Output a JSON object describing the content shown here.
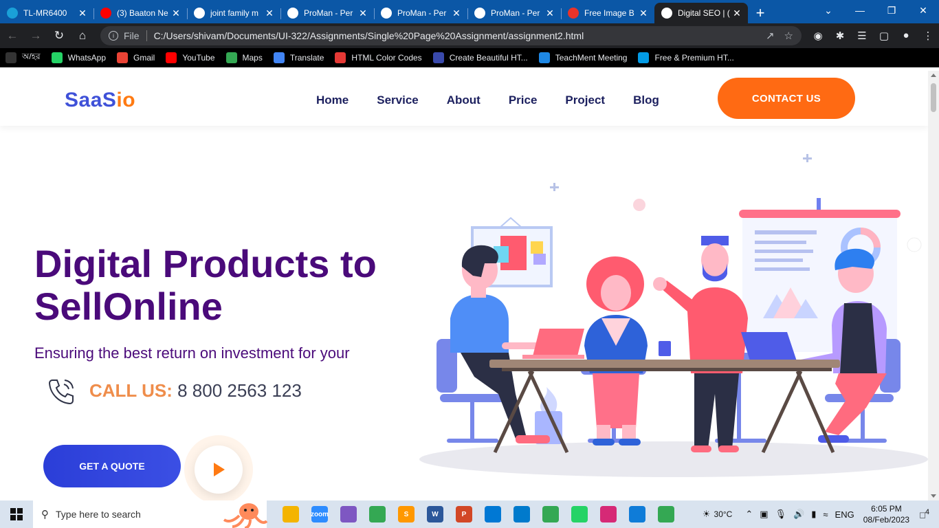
{
  "browser": {
    "tabs": [
      {
        "title": "TL-MR6400",
        "icon": "tplink-icon",
        "color": "#1aa0d8",
        "active": false
      },
      {
        "title": "(3) Baaton Ne",
        "icon": "youtube-icon",
        "color": "#ff0000",
        "active": false
      },
      {
        "title": "joint family m",
        "icon": "google-icon",
        "color": "#ffffff",
        "active": false
      },
      {
        "title": "ProMan - Per",
        "icon": "globe-icon",
        "color": "#ffffff",
        "active": false
      },
      {
        "title": "ProMan - Per",
        "icon": "globe-icon",
        "color": "#ffffff",
        "active": false
      },
      {
        "title": "ProMan - Per",
        "icon": "globe-icon",
        "color": "#ffffff",
        "active": false
      },
      {
        "title": "Free Image B",
        "icon": "adobe-icon",
        "color": "#e8332a",
        "active": false
      },
      {
        "title": "Digital SEO | (",
        "icon": "globe-icon",
        "color": "#ffffff",
        "active": true
      }
    ],
    "address": {
      "scheme_label": "File",
      "url": "C:/Users/shivam/Documents/UI-322/Assignments/Single%20Page%20Assignment/assignment2.html"
    },
    "bookmarks": [
      {
        "label": "অ/হর",
        "icon": "github-icon",
        "color": "#333333"
      },
      {
        "label": "WhatsApp",
        "icon": "whatsapp-icon",
        "color": "#25d366"
      },
      {
        "label": "Gmail",
        "icon": "gmail-icon",
        "color": "#ea4335"
      },
      {
        "label": "YouTube",
        "icon": "youtube-icon",
        "color": "#ff0000"
      },
      {
        "label": "Maps",
        "icon": "maps-icon",
        "color": "#34a853"
      },
      {
        "label": "Translate",
        "icon": "translate-icon",
        "color": "#4285f4"
      },
      {
        "label": "HTML Color Codes",
        "icon": "colorcodes-icon",
        "color": "#e53935"
      },
      {
        "label": "Create Beautiful HT...",
        "icon": "bootstrap-icon",
        "color": "#3949ab"
      },
      {
        "label": "TeachMent Meeting",
        "icon": "teachment-icon",
        "color": "#1e88e5"
      },
      {
        "label": "Free & Premium HT...",
        "icon": "themes-icon",
        "color": "#039be5"
      }
    ]
  },
  "site": {
    "logo": {
      "part1": "SaaS",
      "part2": "io"
    },
    "nav": [
      "Home",
      "Service",
      "About",
      "Price",
      "Project",
      "Blog"
    ],
    "contact_label": "CONTACT US",
    "hero": {
      "title": "Digital Products to SellOnline",
      "subtitle": "Ensuring the best return on investment for your",
      "call_label": "CALL US:",
      "call_number": "8 800 2563 123",
      "quote_label": "GET A QUOTE"
    },
    "colors": {
      "brand_blue": "#3f51d8",
      "brand_orange": "#ff6a13",
      "title_purple": "#4a0a7a"
    }
  },
  "taskbar": {
    "search_placeholder": "Type here to search",
    "apps": [
      {
        "icon": "file-explorer-icon",
        "color": "#f4b400",
        "text": ""
      },
      {
        "icon": "zoom-icon",
        "color": "#2d8cff",
        "text": "zoom"
      },
      {
        "icon": "snipping-icon",
        "color": "#7e57c2",
        "text": ""
      },
      {
        "icon": "chrome-icon",
        "color": "#34a853",
        "text": ""
      },
      {
        "icon": "sublime-icon",
        "color": "#ff9800",
        "text": "S"
      },
      {
        "icon": "word-icon",
        "color": "#2b579a",
        "text": "W"
      },
      {
        "icon": "powerpoint-icon",
        "color": "#d24726",
        "text": "P"
      },
      {
        "icon": "mail-icon",
        "color": "#0078d4",
        "text": ""
      },
      {
        "icon": "vscode-icon",
        "color": "#007acc",
        "text": ""
      },
      {
        "icon": "chrome-profile-icon",
        "color": "#34a853",
        "text": ""
      },
      {
        "icon": "whatsapp-icon",
        "color": "#25d366",
        "text": ""
      },
      {
        "icon": "instagram-icon",
        "color": "#d62976",
        "text": ""
      },
      {
        "icon": "edge-icon",
        "color": "#0f7cd8",
        "text": ""
      },
      {
        "icon": "chrome-alt-icon",
        "color": "#34a853",
        "text": ""
      }
    ],
    "weather": "30°C",
    "language": "ENG",
    "time": "6:05 PM",
    "date": "08/Feb/2023",
    "notifications": "4"
  }
}
